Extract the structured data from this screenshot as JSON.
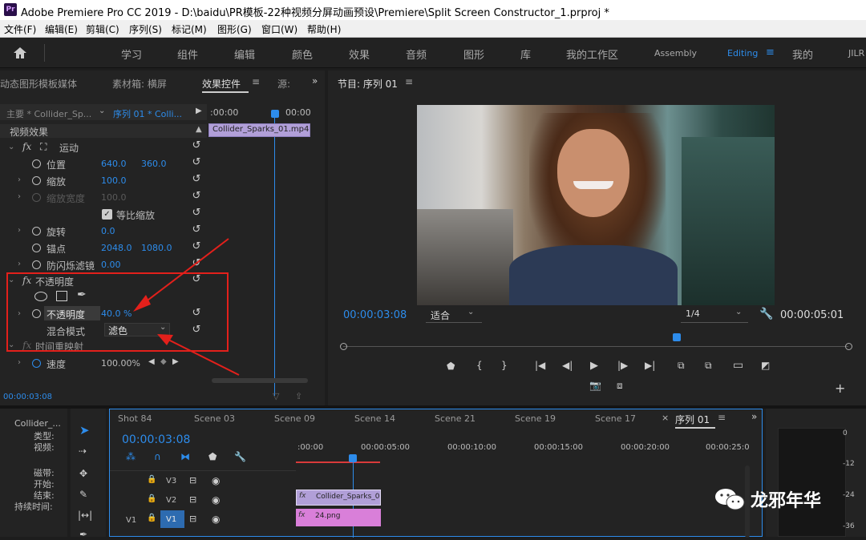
{
  "titlebar": {
    "logo": "Pr",
    "title": "Adobe Premiere Pro CC 2019 - D:\\baidu\\PR模板-22种视频分屏动画预设\\Premiere\\Split Screen Constructor_1.prproj *"
  },
  "menu": [
    "文件(F)",
    "编辑(E)",
    "剪辑(C)",
    "序列(S)",
    "标记(M)",
    "图形(G)",
    "窗口(W)",
    "帮助(H)"
  ],
  "workspaces": [
    "学习",
    "组件",
    "编辑",
    "颜色",
    "效果",
    "音频",
    "图形",
    "库",
    "我的工作区",
    "Assembly",
    "Editing",
    "我的",
    "JILR"
  ],
  "active_workspace": "Editing",
  "effect_panel": {
    "tabs": [
      "动态图形模板媒体",
      "素材箱: 横屏",
      "效果控件",
      "源:"
    ],
    "source_label": "主要 * Collider_Sp...",
    "seq_label": "序列 01 * Colli...",
    "time_left": ":00:00",
    "time_right": "00:00",
    "clip_name": "Collider_Sparks_01.mp4",
    "section": "视频效果",
    "motion": "运动",
    "position_label": "位置",
    "position_x": "640.0",
    "position_y": "360.0",
    "scale_label": "缩放",
    "scale_val": "100.0",
    "scale_w_label": "缩放宽度",
    "scale_w_val": "100.0",
    "uniform_label": "等比缩放",
    "rotate_label": "旋转",
    "rotate_val": "0.0",
    "anchor_label": "锚点",
    "anchor_x": "2048.0",
    "anchor_y": "1080.0",
    "flicker_label": "防闪烁滤镜",
    "flicker_val": "0.00",
    "opacity_section": "不透明度",
    "opacity_label": "不透明度",
    "opacity_val": "40.0 %",
    "blend_label": "混合模式",
    "blend_val": "滤色",
    "time_remap": "时间重映射",
    "speed_label": "速度",
    "speed_val": "100.00%",
    "current_time": "00:00:03:08"
  },
  "program": {
    "tab": "节目: 序列 01",
    "timecode": "00:00:03:08",
    "fit": "适合",
    "quality": "1/4",
    "duration": "00:00:05:01",
    "playhead_pct": 0.66
  },
  "timeline": {
    "project_label": "Collider_...",
    "info": [
      "类型:",
      "视频:",
      "磁带:",
      "开始:",
      "结束:",
      "持续时间:"
    ],
    "seq_tabs": [
      "Shot 84",
      "Scene 03",
      "Scene 09",
      "Scene 14",
      "Scene 21",
      "Scene 19",
      "Scene 17",
      "序列 01"
    ],
    "timecode": "00:00:03:08",
    "ruler": [
      ":00:00",
      "00:00:05:00",
      "00:00:10:00",
      "00:00:15:00",
      "00:00:20:00",
      "00:00:25:0"
    ],
    "tracks": [
      "V3",
      "V2",
      "V1"
    ],
    "source_track": "V1",
    "clip_v2": "Collider_Sparks_0",
    "clip_v1": "24.png",
    "fx": "fx"
  },
  "meter_ticks": [
    "0",
    "-12",
    "-24",
    "-36"
  ],
  "watermark": "龙邪年华",
  "colors": {
    "accent": "#2d8ceb",
    "annotation": "#e3201b",
    "clip_v2": "#b19fd8",
    "clip_v1": "#d97fd9"
  }
}
